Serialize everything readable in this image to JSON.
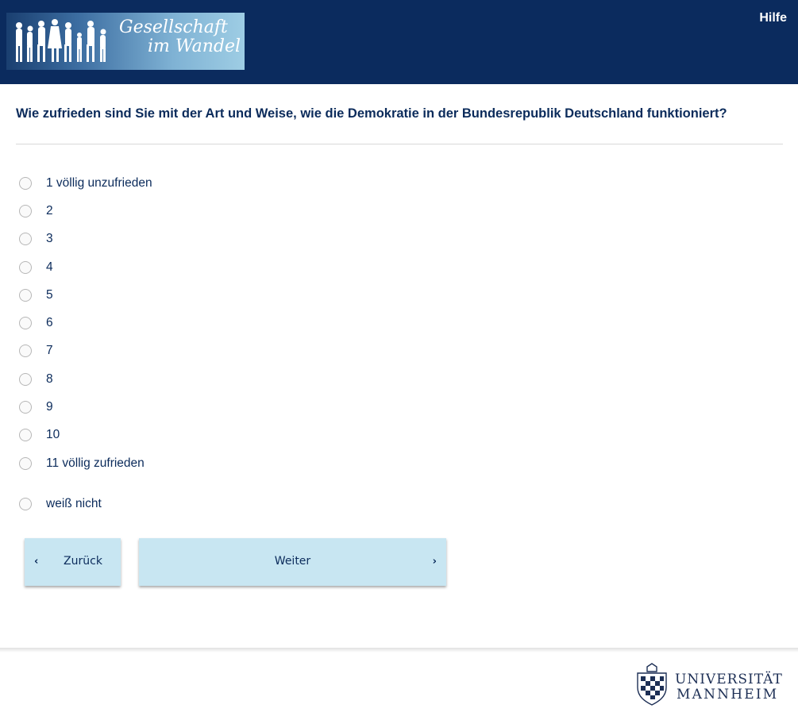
{
  "header": {
    "logo_line1": "Gesellschaft",
    "logo_line2": "im Wandel",
    "help_label": "Hilfe"
  },
  "question": {
    "text": "Wie zufrieden sind Sie mit der Art und Weise, wie die Demokratie in der Bundesrepublik Deutschland funktioniert?",
    "options": [
      "1 völlig unzufrieden",
      "2",
      "3",
      "4",
      "5",
      "6",
      "7",
      "8",
      "9",
      "10",
      "11 völlig zufrieden"
    ],
    "dont_know": "weiß nicht"
  },
  "nav": {
    "back_label": "Zurück",
    "next_label": "Weiter"
  },
  "footer": {
    "uni_line1": "UNIVERSITÄT",
    "uni_line2": "MANNHEIM"
  },
  "colors": {
    "header_bg": "#0b2b5e",
    "text": "#0b2b5b",
    "button_bg": "#c8e6f2"
  }
}
